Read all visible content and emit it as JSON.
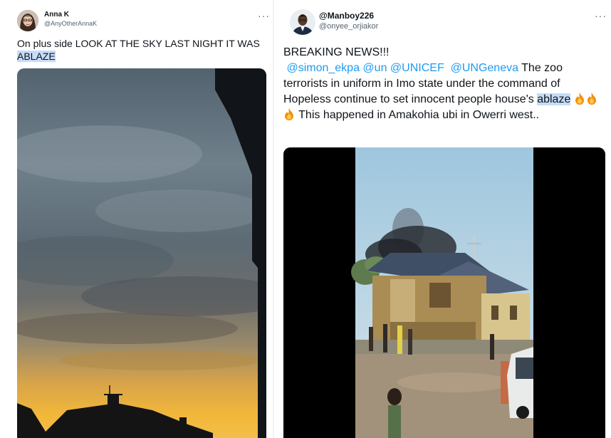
{
  "tweets": [
    {
      "display_name": "Anna K",
      "handle": "@AnyOtherAnnaK",
      "text_before": "On plus side LOOK AT THE SKY LAST NIGHT IT WAS ",
      "highlight": "ABLAZE",
      "more_label": "···",
      "media": "sunset-sky-photo"
    },
    {
      "display_name": "@Manboy226",
      "handle": "@onyee_orjiakor",
      "headline": "BREAKING NEWS!!!",
      "mentions": [
        "@simon_ekpa",
        "@un",
        "@UNICEF",
        "@UNGeneva"
      ],
      "text_after_mentions": " The zoo terrorists in uniform in Imo state under the command of Hopeless continue to set innocent people house's ",
      "highlight": "ablaze",
      "emoji": [
        "fire-emoji",
        "fire-emoji",
        "fire-emoji"
      ],
      "text_end": " This happened in Amakohia ubi in Owerri west..",
      "more_label": "···",
      "media": "burning-house-video"
    }
  ],
  "colors": {
    "accent": "#1d9bf0",
    "highlight": "#c6dcf7",
    "secondary_text": "#536471"
  }
}
